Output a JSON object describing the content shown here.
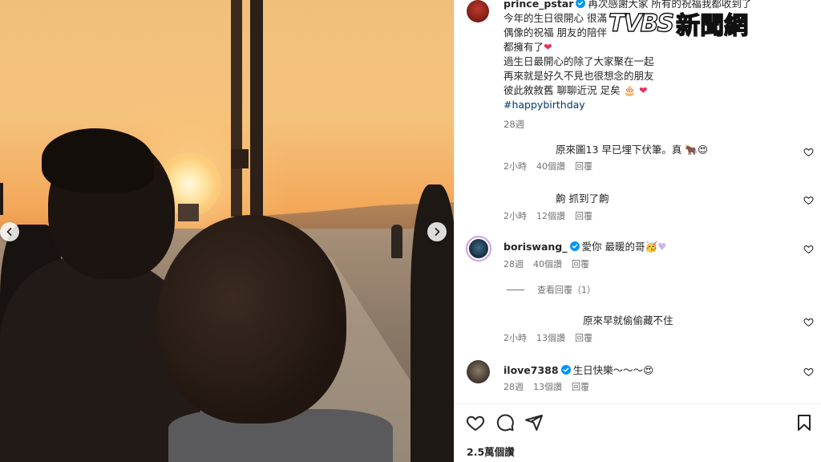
{
  "post": {
    "username": "prince_pstar",
    "caption_lines": [
      "再次感謝大家 所有的祝福我都收到了",
      "今年的生日很開心 很滿",
      "偶像的祝福 朋友的陪伴",
      "都擁有了",
      "過生日最開心的除了大家聚在一起",
      "再來就是好久不見也很想念的朋友",
      "彼此敘敘舊 聊聊近況 足矣"
    ],
    "hashtag": "#happybirthday",
    "time": "28週"
  },
  "watermark": {
    "brand": "TVBS",
    "text": "新聞網"
  },
  "comments": [
    {
      "username": "",
      "text": "原來圖13 早已埋下伏筆。真",
      "time": "2小時",
      "likes": "40個讚",
      "reply": "回覆"
    },
    {
      "username": "",
      "text": "齁 抓到了齁",
      "time": "2小時",
      "likes": "12個讚",
      "reply": "回覆"
    },
    {
      "username": "boriswang_",
      "text": "愛你 最暖的哥",
      "time": "28週",
      "likes": "40個讚",
      "reply": "回覆"
    },
    {
      "username": "",
      "text": "原來早就偷偷藏不住",
      "time": "2小時",
      "likes": "13個讚",
      "reply": "回覆"
    },
    {
      "username": "ilove7388",
      "text": "生日快樂～～～",
      "time": "28週",
      "likes": "13個讚",
      "reply": "回覆"
    }
  ],
  "view_replies": "查看回覆（1）",
  "likes_count": "2.5萬個讚",
  "colors": {
    "verified": "#0095f6",
    "link": "#00376b",
    "muted": "#737373",
    "heart": "#ed2d5a"
  },
  "icons": [
    "chevron-left-icon",
    "chevron-right-icon",
    "verified-badge-icon",
    "heart-outline-icon",
    "comment-icon",
    "share-icon",
    "bookmark-icon"
  ]
}
